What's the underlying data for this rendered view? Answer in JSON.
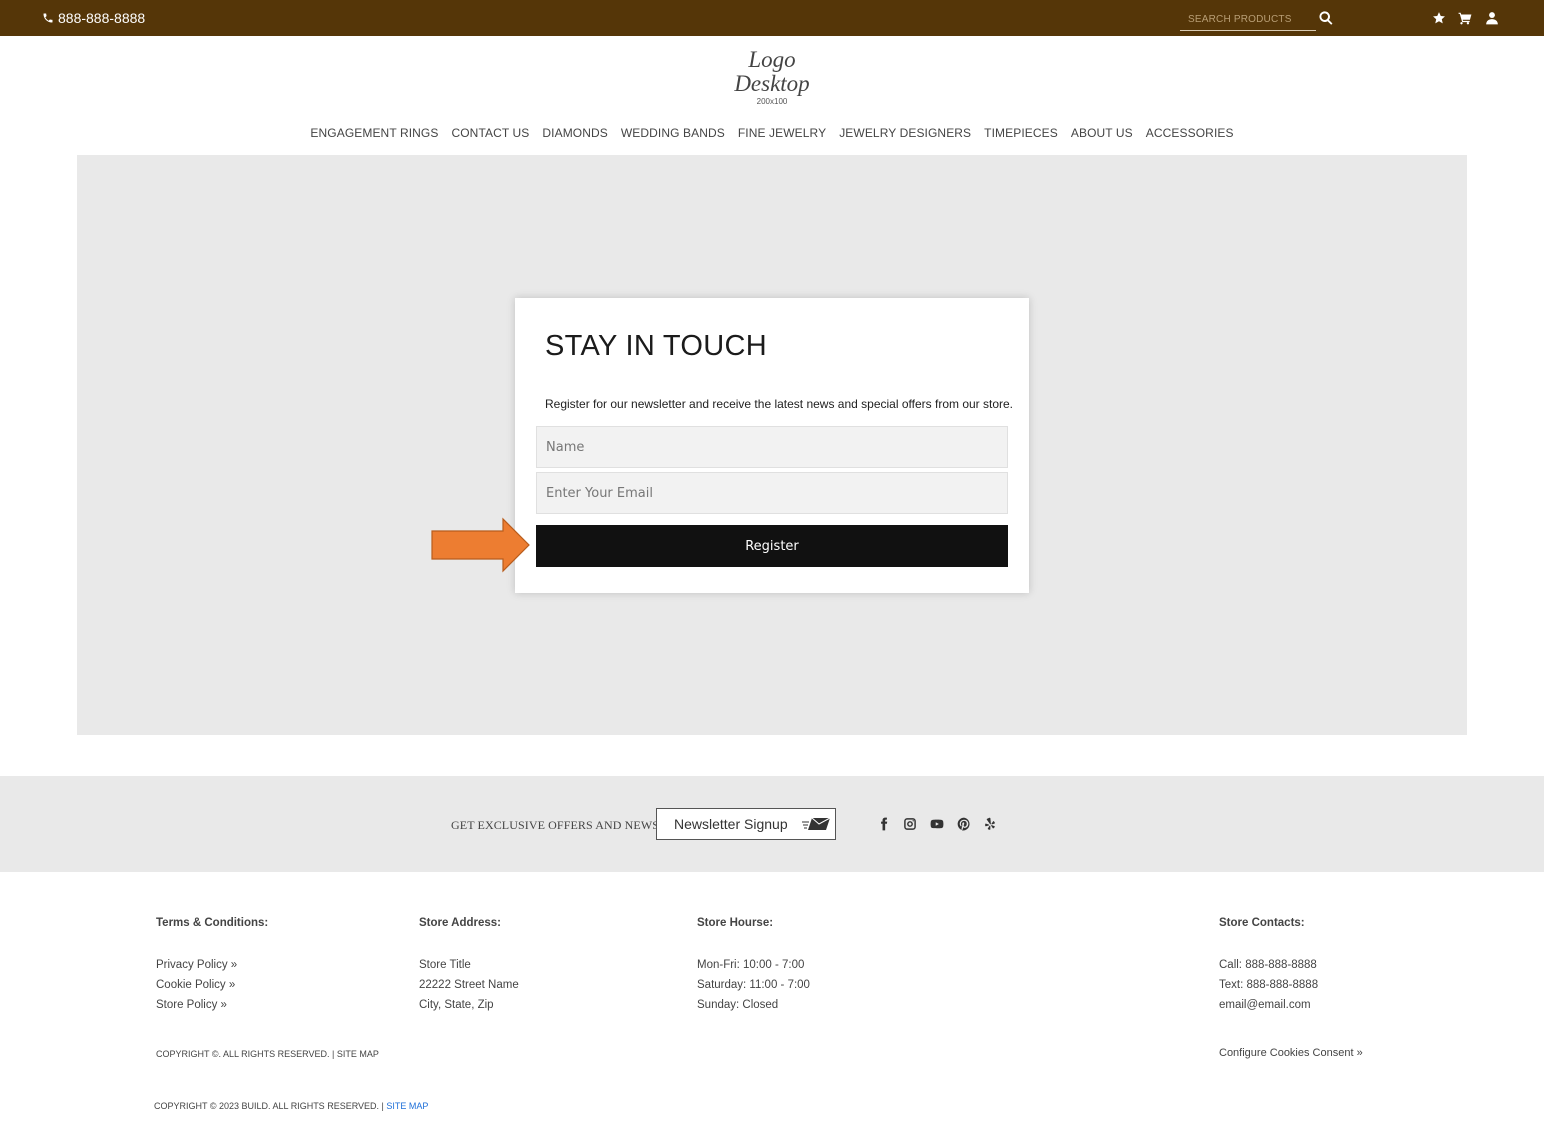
{
  "topbar": {
    "phone": "888-888-8888",
    "search_placeholder": "SEARCH PRODUCTS"
  },
  "logo": {
    "line1": "Logo",
    "line2": "Desktop",
    "size": "200x100"
  },
  "nav": {
    "items": [
      "ENGAGEMENT RINGS",
      "CONTACT US",
      "DIAMONDS",
      "WEDDING BANDS",
      "FINE JEWELRY",
      "JEWELRY DESIGNERS",
      "TIMEPIECES",
      "ABOUT US",
      "ACCESSORIES"
    ]
  },
  "signup_card": {
    "title": "STAY IN TOUCH",
    "text": "Register for our newsletter and receive the latest news and special offers from our store.",
    "name_placeholder": "Name",
    "email_placeholder": "Enter Your Email",
    "button_label": "Register"
  },
  "band": {
    "text": "GET EXCLUSIVE OFFERS AND NEWS.",
    "signup_label": "Newsletter Signup"
  },
  "footer": {
    "terms": {
      "heading": "Terms & Conditions:",
      "links": [
        "Privacy Policy »",
        "Cookie Policy »",
        "Store Policy »"
      ]
    },
    "address": {
      "heading": "Store Address:",
      "lines": [
        "Store Title",
        "22222 Street Name",
        "City, State, Zip"
      ]
    },
    "hours": {
      "heading": "Store Hourse:",
      "lines": [
        "Mon-Fri: 10:00 - 7:00",
        "Saturday: 11:00 - 7:00",
        "Sunday: Closed"
      ]
    },
    "contacts": {
      "heading": "Store Contacts:",
      "lines": [
        "Call: 888-888-8888",
        "Text: 888-888-8888",
        "email@email.com"
      ]
    },
    "copyright1": "COPYRIGHT ©. ALL RIGHTS RESERVED. | SITE MAP",
    "cookie_consent": "Configure Cookies Consent »",
    "copyright2": "COPYRIGHT © 2023 BUILD. ALL RIGHTS RESERVED. | ",
    "copyright2_link": "SITE MAP"
  },
  "colors": {
    "topbar": "#553608",
    "hero_bg": "#e9e9e9",
    "button": "#111111",
    "arrow": "#ed7d31"
  }
}
